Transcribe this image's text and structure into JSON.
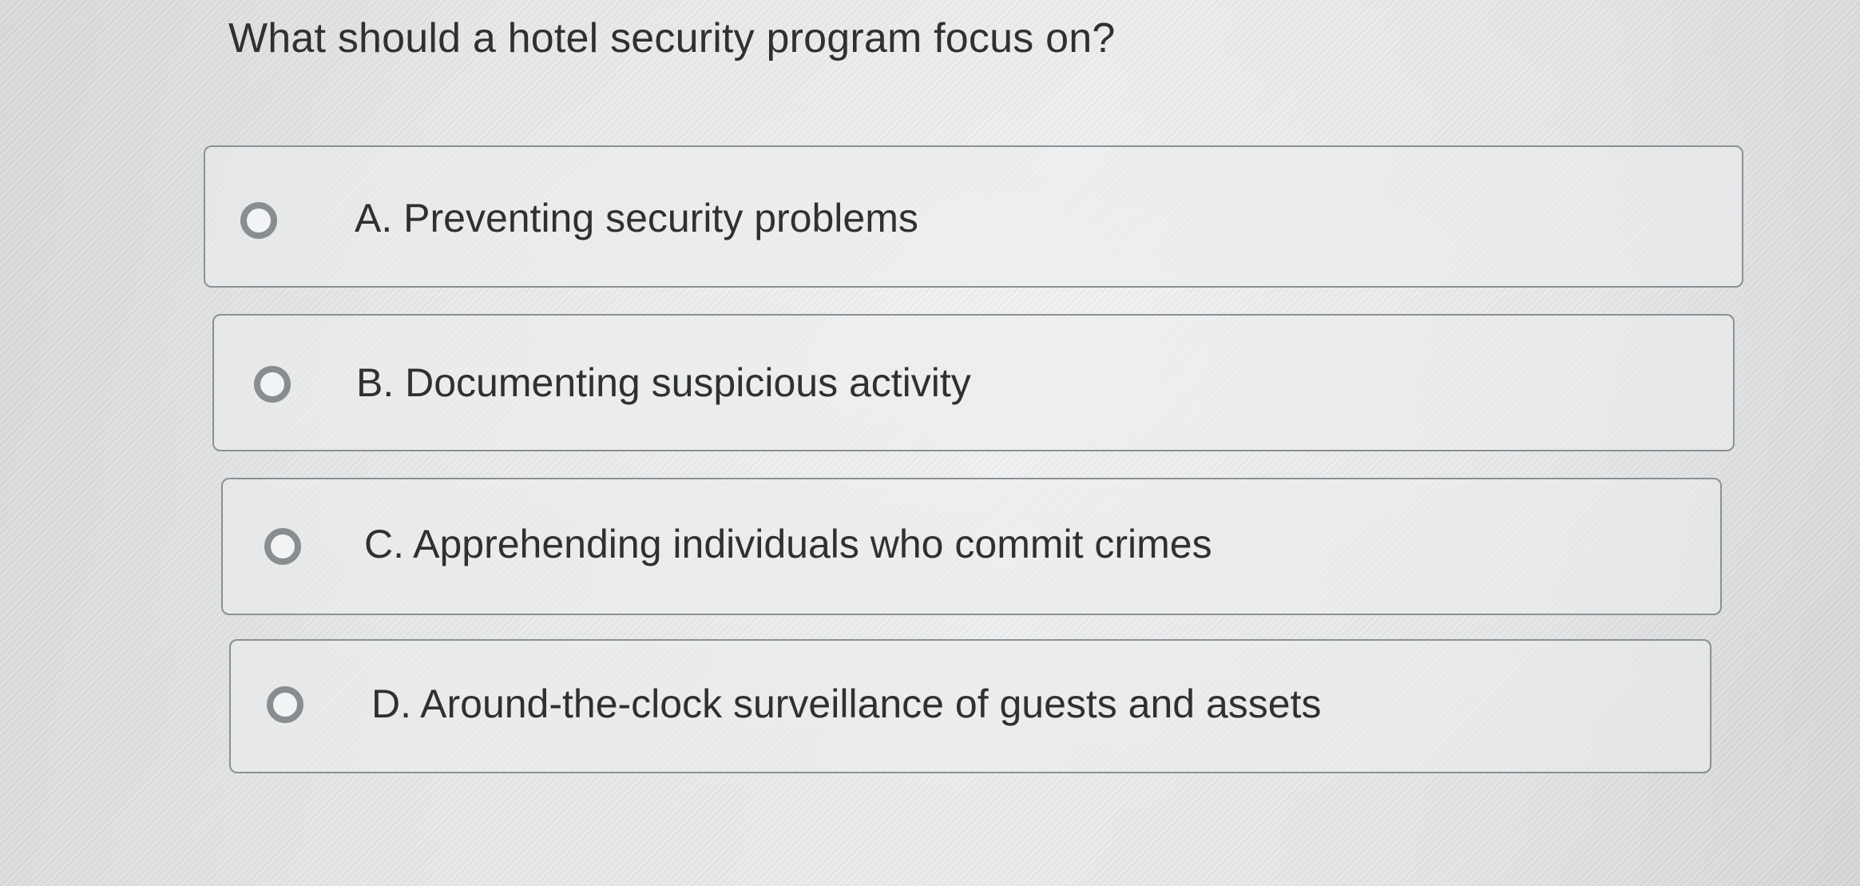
{
  "question": {
    "text": "What should a hotel security program focus on?"
  },
  "options": [
    {
      "letter": "A",
      "label": "A. Preventing security problems",
      "selected": false
    },
    {
      "letter": "B",
      "label": "B. Documenting suspicious activity",
      "selected": false
    },
    {
      "letter": "C",
      "label": "C. Apprehending individuals who commit crimes",
      "selected": false
    },
    {
      "letter": "D",
      "label": "D. Around-the-clock surveillance of guests and assets",
      "selected": false
    }
  ],
  "colors": {
    "border": "#8d9093",
    "radio_ring": "#8a8d90",
    "text": "#2e3032",
    "background": "#e4e6e7"
  }
}
